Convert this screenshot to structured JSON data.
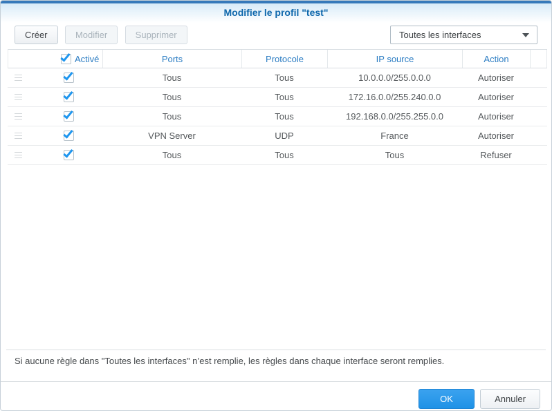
{
  "dialog": {
    "title": "Modifier le profil \"test\""
  },
  "toolbar": {
    "create_label": "Créer",
    "modify_label": "Modifier",
    "delete_label": "Supprimer",
    "interface_select": {
      "value": "Toutes les interfaces",
      "icon": "chevron-down-icon"
    }
  },
  "table": {
    "columns": {
      "enabled": "Activé",
      "ports": "Ports",
      "protocol": "Protocole",
      "source_ip": "IP source",
      "action": "Action"
    },
    "select_all_checked": true,
    "rows": [
      {
        "enabled": true,
        "ports": "Tous",
        "protocol": "Tous",
        "source_ip": "10.0.0.0/255.0.0.0",
        "action": "Autoriser"
      },
      {
        "enabled": true,
        "ports": "Tous",
        "protocol": "Tous",
        "source_ip": "172.16.0.0/255.240.0.0",
        "action": "Autoriser"
      },
      {
        "enabled": true,
        "ports": "Tous",
        "protocol": "Tous",
        "source_ip": "192.168.0.0/255.255.0.0",
        "action": "Autoriser"
      },
      {
        "enabled": true,
        "ports": "VPN Server",
        "protocol": "UDP",
        "source_ip": "France",
        "action": "Autoriser"
      },
      {
        "enabled": true,
        "ports": "Tous",
        "protocol": "Tous",
        "source_ip": "Tous",
        "action": "Refuser"
      }
    ]
  },
  "footer": {
    "note": "Si aucune règle dans \"Toutes les interfaces\" n’est remplie, les règles dans chaque interface seront remplies.",
    "ok_label": "OK",
    "cancel_label": "Annuler"
  },
  "colors": {
    "topbar_blue": "#3679ba",
    "title_blue": "#0f68ac",
    "header_text_blue": "#2c7dc3",
    "checkmark_blue": "#1e96ef",
    "ok_button_blue": "#2f9ce8"
  }
}
